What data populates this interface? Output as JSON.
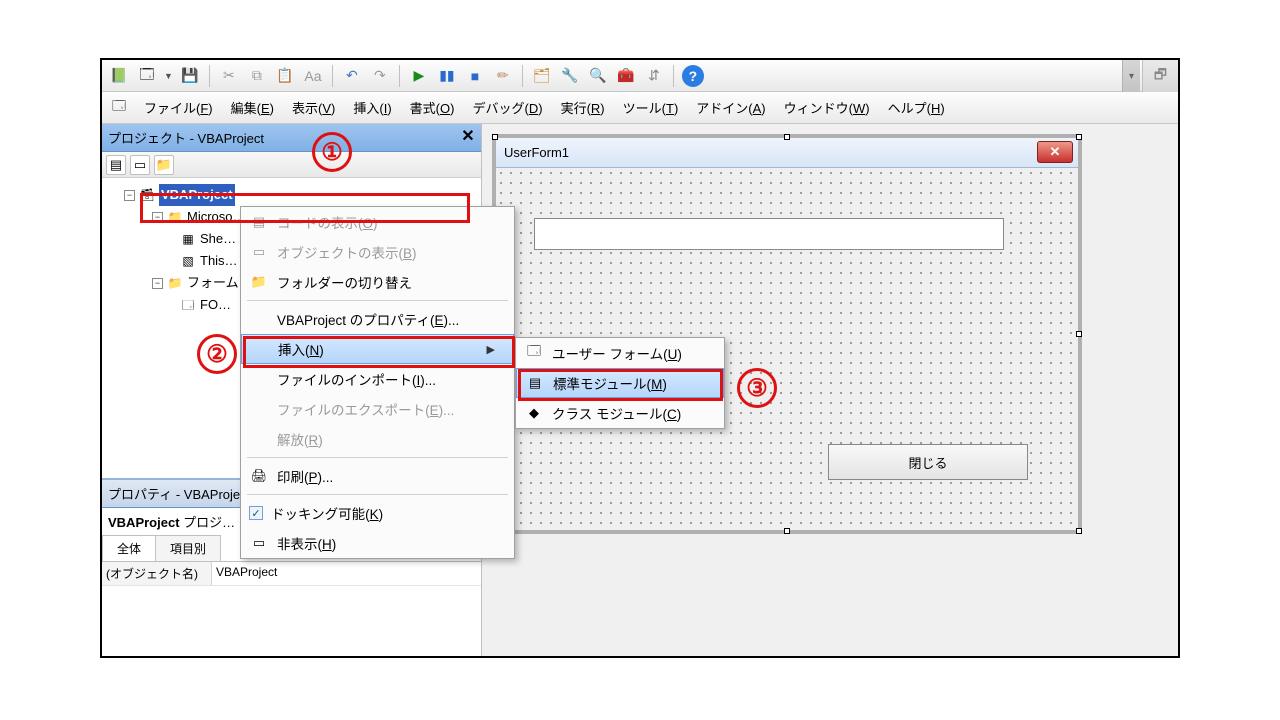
{
  "menubar": {
    "file": "ファイル(F)",
    "edit": "編集(E)",
    "view": "表示(V)",
    "insert": "挿入(I)",
    "format": "書式(O)",
    "debug": "デバッグ(D)",
    "run": "実行(R)",
    "tools": "ツール(T)",
    "addins": "アドイン(A)",
    "window": "ウィンドウ(W)",
    "help": "ヘルプ(H)"
  },
  "project_pane": {
    "title": "プロジェクト - VBAProject",
    "tree": {
      "root": "VBAProject",
      "root_suffix": " (…",
      "excel_objs": "Microso…",
      "sheet": "She…",
      "thiswb": "This…",
      "forms": "フォーム",
      "form1": "FO…"
    }
  },
  "properties_pane": {
    "header": "プロパティ - VBAProjec…",
    "title_object": "VBAProject",
    "title_type": "プロジ…",
    "tab_all": "全体",
    "tab_cat": "項目別",
    "row_name_label": "(オブジェクト名)",
    "row_name_value": "VBAProject"
  },
  "userform": {
    "title": "UserForm1",
    "btn_close": "閉じる"
  },
  "context_main": {
    "view_code": "コードの表示(O)",
    "view_obj": "オブジェクトの表示(B)",
    "toggle_fld": "フォルダーの切り替え",
    "proj_props": "VBAProject のプロパティ(E)...",
    "insert": "挿入(N)",
    "import": "ファイルのインポート(I)...",
    "export": "ファイルのエクスポート(E)...",
    "release": "解放(R)",
    "print": "印刷(P)...",
    "docking": "ドッキング可能(K)",
    "hide": "非表示(H)"
  },
  "context_insert": {
    "userform": "ユーザー フォーム(U)",
    "module": "標準モジュール(M)",
    "class": "クラス モジュール(C)"
  },
  "annotations": {
    "a1": "①",
    "a2": "②",
    "a3": "③"
  },
  "icons": {
    "excel": "📗",
    "form": "🗔",
    "save": "💾",
    "cut": "✂",
    "copy": "⧉",
    "paste": "📋",
    "undo": "↶",
    "redo": "↷",
    "play": "▶",
    "pause": "▮▮",
    "stop": "■",
    "design": "✏",
    "projexp": "🗂",
    "propwin": "🔧",
    "objbrw": "🔍",
    "toolbox": "🧰",
    "taborder": "⇵",
    "help": "?",
    "folder": "📁",
    "sheet": "▦",
    "thiswb": "▧",
    "module": "▤",
    "class": "◆",
    "print": "🖨",
    "code": "▤",
    "obj": "▭",
    "hide": "▭"
  }
}
